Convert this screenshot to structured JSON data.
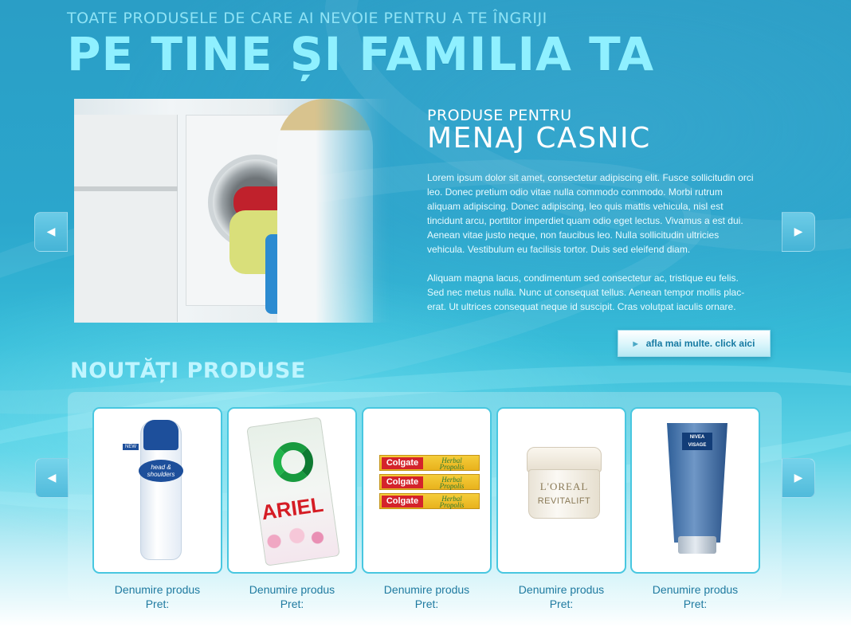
{
  "header": {
    "subtitle": "TOATE PRODUSELE DE CARE AI NEVOIE PENTRU A TE ÎNGRIJI",
    "title": "PE TINE ȘI FAMILIA TA"
  },
  "hero": {
    "kicker": "PRODUSE PENTRU",
    "heading": "MENAJ CASNIC",
    "paragraph1": "Lorem ipsum dolor sit amet, consectetur adipiscing elit. Fusce sollicitudin orci leo. Donec pretium odio vitae nulla commodo commodo. Morbi rutrum aliquam adipiscing. Donec adipiscing, leo quis mattis vehicula, nisl est tincidunt arcu, porttitor imperdiet quam odio eget lectus. Vivamus a est dui. Aenean vitae justo neque, non faucibus leo. Nulla sollicitudin ultricies vehicula. Vestibulum eu facilisis tortor. Duis sed eleifend diam.",
    "paragraph2": "Aliquam magna lacus, condimentum sed consectetur ac, tristique eu felis. Sed nec metus nulla. Nunc ut consequat tellus. Aenean tempor mollis plac-erat. Ut ultrices consequat neque id suscipit. Cras volutpat iaculis ornare.",
    "button_label": "afla mai multe. click aici",
    "prev_icon": "◀",
    "next_icon": "▶"
  },
  "news": {
    "title": "NOUTĂȚI PRODUSE",
    "prev_icon": "◀",
    "next_icon": "▶",
    "products": [
      {
        "name": "Denumire produs",
        "price": "Pret:",
        "image": "shampoo",
        "brand_text": "head & shoulders",
        "badge": "NEW"
      },
      {
        "name": "Denumire produs",
        "price": "Pret:",
        "image": "detergent",
        "brand_text": "ARIEL"
      },
      {
        "name": "Denumire produs",
        "price": "Pret:",
        "image": "toothpaste",
        "brand_text": "Colgate",
        "sub_text": "Herbal Propolis"
      },
      {
        "name": "Denumire produs",
        "price": "Pret:",
        "image": "cream-jar",
        "brand_text": "L'OREAL",
        "sub_text": "REVITALIFT"
      },
      {
        "name": "Denumire produs",
        "price": "Pret:",
        "image": "face-wash-tube",
        "brand_text": "NIVEA VISAGE"
      }
    ]
  },
  "colors": {
    "title": "#8ff0ff",
    "card_border": "#48c7e0",
    "product_text": "#1f7aa0",
    "button_text": "#167aa2"
  }
}
